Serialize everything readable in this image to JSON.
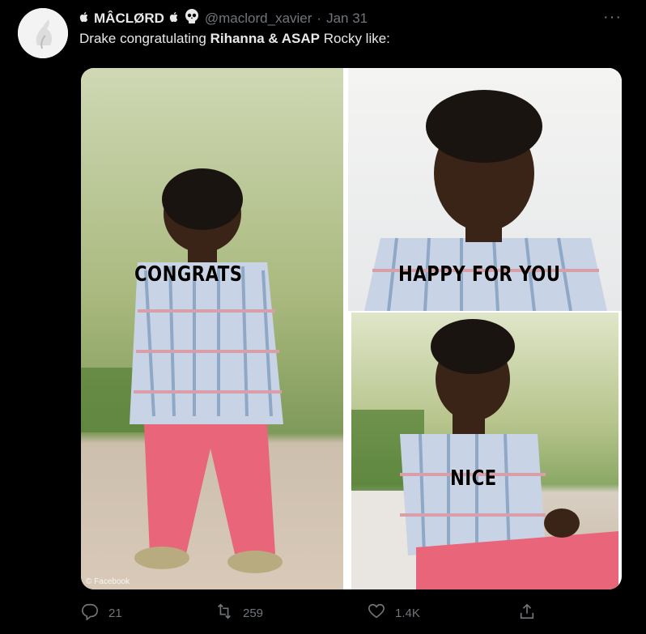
{
  "author": {
    "display_name": "ᴉMÂCLØRDᴉ ☠",
    "display_name_text": "MÂCLØRD",
    "handle": "@maclord_xavier",
    "separator": "·",
    "date": "Jan 31"
  },
  "more_label": "···",
  "tweet": {
    "prefix": "Drake congratulating ",
    "bold1": "Rihanna & ASAP",
    "suffix": " Rocky like:"
  },
  "media": {
    "captions": [
      "CONGRATS",
      "HAPPY FOR YOU",
      "NICE"
    ],
    "watermark": "© Facebook"
  },
  "actions": {
    "replies": "21",
    "retweets": "259",
    "likes": "1.4K"
  },
  "icons": [
    "apple-logo-icon",
    "skull-icon",
    "more-icon",
    "reply-icon",
    "retweet-icon",
    "like-icon",
    "share-icon"
  ]
}
